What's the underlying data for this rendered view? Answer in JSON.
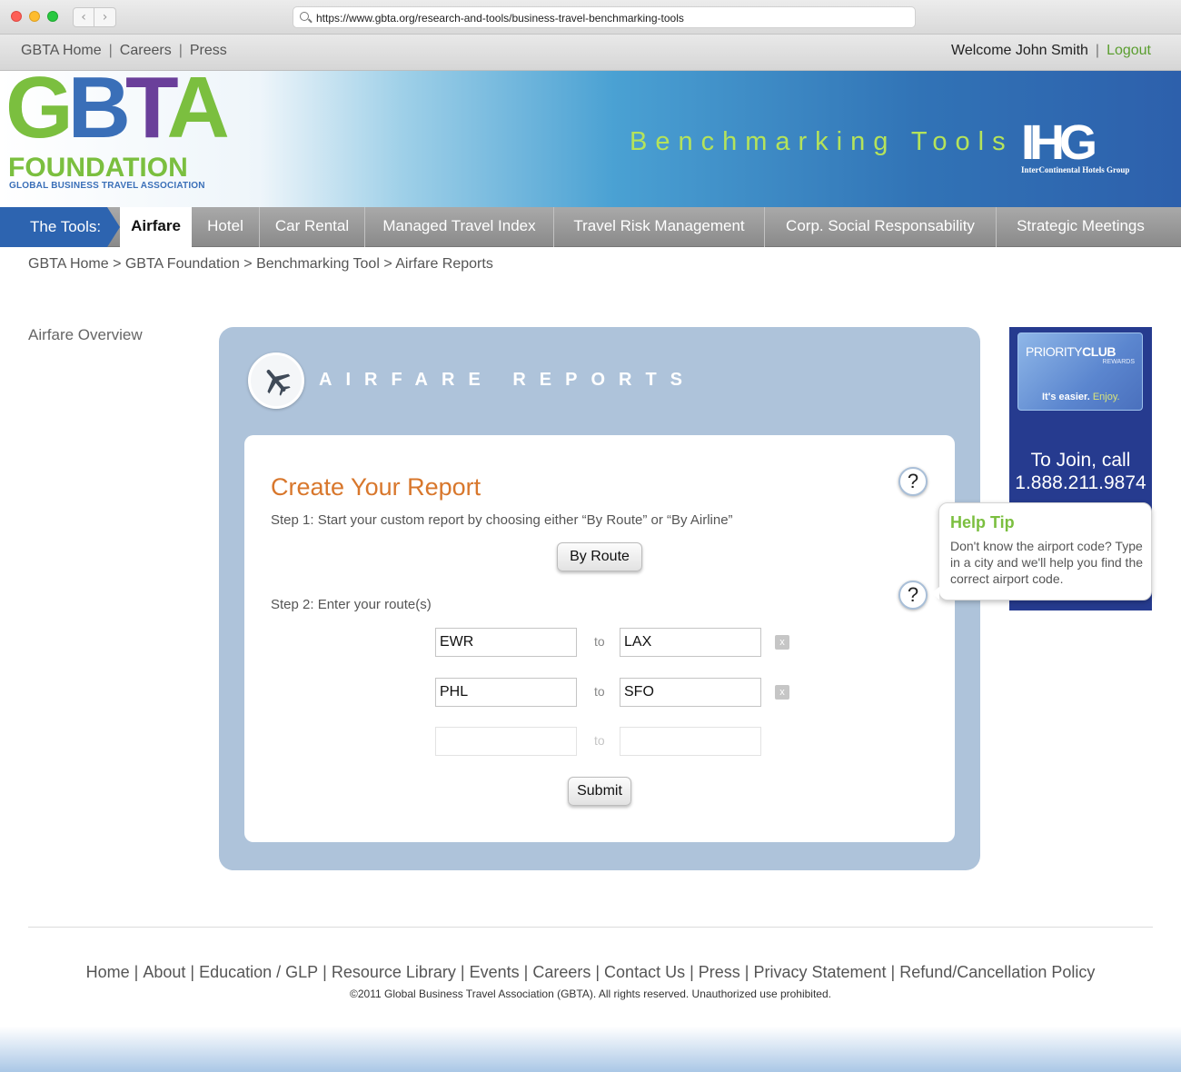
{
  "browser": {
    "url": "https://www.gbta.org/research-and-tools/business-travel-benchmarking-tools",
    "back_glyph": "‹",
    "forward_glyph": "›"
  },
  "topbar": {
    "links": [
      "GBTA Home",
      "Careers",
      "Press"
    ],
    "welcome": "Welcome John Smith",
    "logout": "Logout"
  },
  "banner": {
    "logo": {
      "letters": [
        "G",
        "B",
        "T",
        "A"
      ],
      "foundation": "FOUNDATION",
      "association": "GLOBAL BUSINESS TRAVEL ASSOCIATION"
    },
    "title": "Benchmarking Tools",
    "sponsor_mark": "IHG",
    "sponsor_name": "InterContinental Hotels Group"
  },
  "tools_nav": {
    "label": "The Tools:",
    "tabs": [
      "Airfare",
      "Hotel",
      "Car Rental",
      "Managed Travel Index",
      "Travel Risk Management",
      "Corp. Social Responsability",
      "Strategic Meetings"
    ],
    "active": "Airfare"
  },
  "breadcrumb": "GBTA Home > GBTA Foundation > Benchmarking Tool > Airfare Reports",
  "sidebar": {
    "link": "Airfare Overview"
  },
  "panel": {
    "title": "AIRFARE REPORTS",
    "card_title": "Create Your Report",
    "step1": "Step 1: Start your custom report by choosing either “By Route” or “By Airline”",
    "by_route_button": "By Route",
    "step2": "Step 2: Enter your route(s)",
    "to_label": "to",
    "routes": [
      {
        "from": "EWR",
        "to": "LAX"
      },
      {
        "from": "PHL",
        "to": "SFO"
      },
      {
        "from": "",
        "to": ""
      }
    ],
    "remove_glyph": "x",
    "submit_button": "Submit",
    "help_glyph": "?"
  },
  "ad": {
    "brand_a": "PRIORITY",
    "brand_b": "CLUB",
    "rewards": "REWARDS",
    "tagline_a": "It's easier.",
    "tagline_b": "Enjoy.",
    "join_line1": "To Join, call",
    "join_line2": "1.888.211.9874"
  },
  "help_tip": {
    "title": "Help Tip",
    "body": "Don't know the airport code? Type in a city and we'll help you find the correct airport code."
  },
  "footer": {
    "links": [
      "Home",
      "About",
      "Education / GLP",
      "Resource Library",
      "Events",
      "Careers",
      "Contact Us",
      "Press",
      "Privacy Statement",
      "Refund/Cancellation Policy"
    ],
    "copyright": "©2011 Global Business Travel Association (GBTA). All rights reserved. Unauthorized use prohibited."
  },
  "colors": {
    "accent_blue": "#2d64b0",
    "brand_green": "#7bbf3f",
    "title_orange": "#d8772c",
    "panel_blue": "#aec3da"
  }
}
